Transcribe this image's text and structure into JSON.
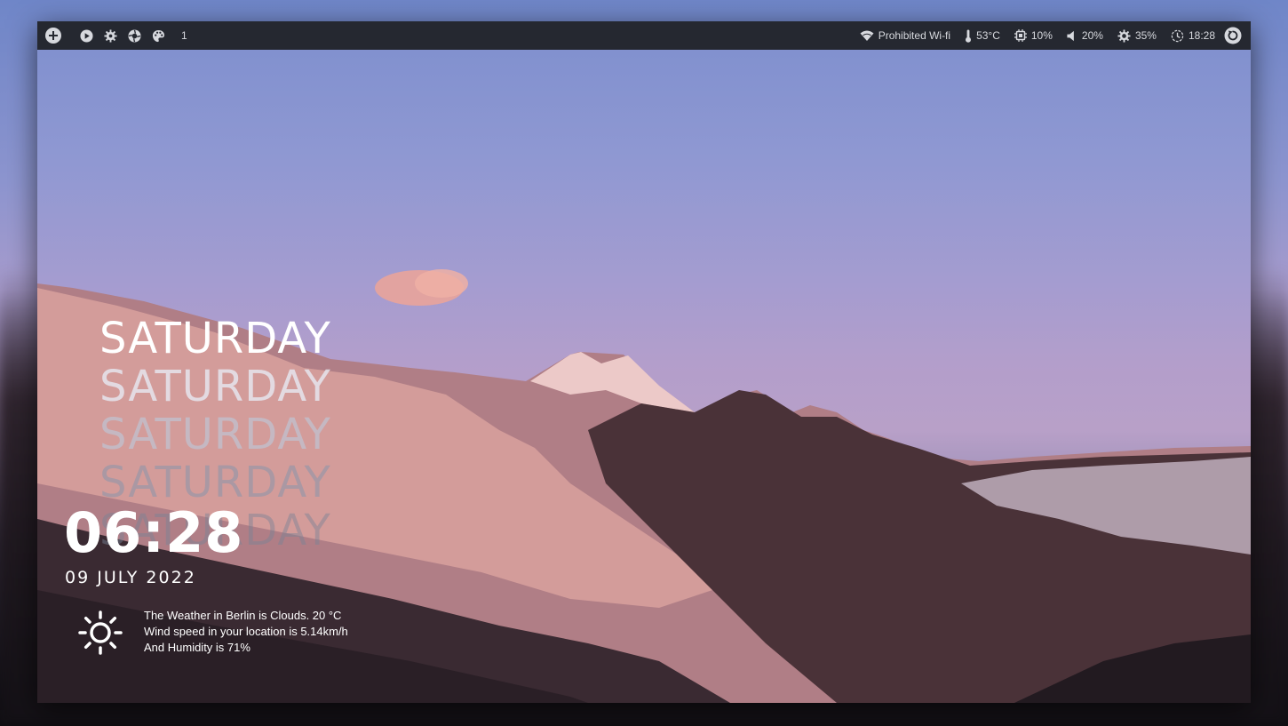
{
  "topbar": {
    "left_icons": [
      "plus-circle-icon",
      "play-icon",
      "gear-icon",
      "aperture-icon",
      "palette-icon"
    ],
    "workspace": "1",
    "wifi": {
      "icon": "wifi-icon",
      "label": "Prohibited Wi-fi"
    },
    "temperature": {
      "icon": "thermometer-icon",
      "label": "53°C"
    },
    "cpu": {
      "icon": "cpu-icon",
      "label": "10%"
    },
    "volume": {
      "icon": "volume-icon",
      "label": "20%"
    },
    "brightness": {
      "icon": "brightness-icon",
      "label": "35%"
    },
    "clock": {
      "icon": "clock-icon",
      "label": "18:28"
    },
    "power_icon": "power-icon"
  },
  "desktop": {
    "day_lines": [
      "SATURDAY",
      "SATURDAY",
      "SATURDAY",
      "SATURDAY",
      "SATURDAY"
    ],
    "time": "06:28",
    "date": "09 JULY 2022",
    "weather": {
      "icon": "sun-icon",
      "line1": "The Weather in Berlin is Clouds. 20 °C",
      "line2": "Wind speed in your location is 5.14km/h",
      "line3": "And Humidity is 71%"
    }
  },
  "colors": {
    "bar_bg": "#252830",
    "text": "#d7d9de",
    "accent": "#ffffff"
  }
}
